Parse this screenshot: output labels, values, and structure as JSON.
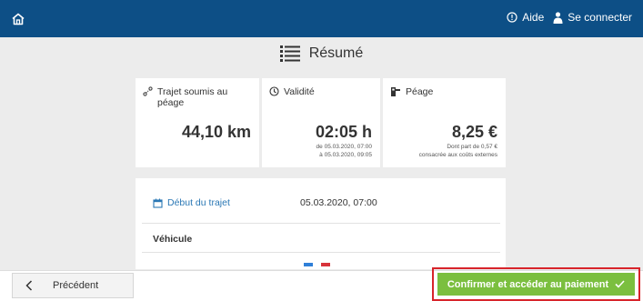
{
  "header": {
    "help_label": "Aide",
    "login_label": "Se connecter"
  },
  "page": {
    "title": "Résumé"
  },
  "cards": {
    "trajet": {
      "label": "Trajet soumis au péage",
      "value": "44,10 km"
    },
    "validite": {
      "label": "Validité",
      "value": "02:05 h",
      "from": "de 05.03.2020, 07:00",
      "to": "à 05.03.2020, 09:05"
    },
    "peage": {
      "label": "Péage",
      "value": "8,25 €",
      "note1": "Dont part de 0,57 €",
      "note2": "consacrée aux coûts externes"
    }
  },
  "details": {
    "start_label": "Début du trajet",
    "start_value": "05.03.2020, 07:00",
    "vehicle_label": "Véhicule"
  },
  "footer": {
    "prev_label": "Précédent",
    "confirm_label": "Confirmer et accéder au paiement"
  },
  "colors": {
    "topbar": "#0d4f86",
    "link": "#2b78b5",
    "confirm": "#7bbf3f",
    "highlight": "#d8242b"
  }
}
